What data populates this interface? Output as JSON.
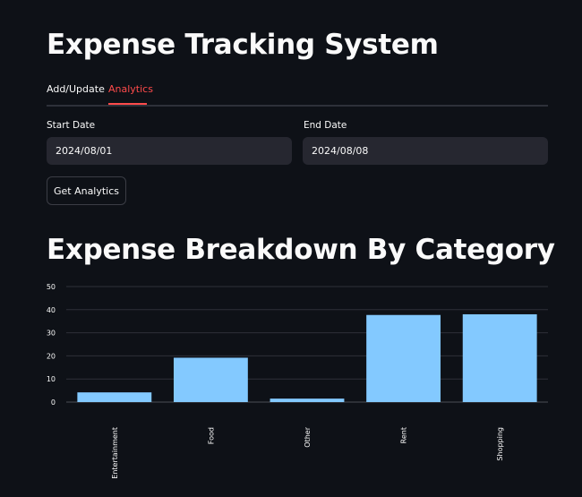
{
  "app": {
    "title": "Expense Tracking System"
  },
  "tabs": [
    {
      "label": "Add/Update",
      "active": false
    },
    {
      "label": "Analytics",
      "active": true
    }
  ],
  "form": {
    "start_date_label": "Start Date",
    "start_date_value": "2024/08/01",
    "end_date_label": "End Date",
    "end_date_value": "2024/08/08",
    "submit_label": "Get Analytics"
  },
  "section": {
    "title": "Expense Breakdown By Category"
  },
  "colors": {
    "background": "#0e1117",
    "accent": "#ff4b4b",
    "bar": "#83c9ff",
    "input_bg": "#262730"
  },
  "chart_data": {
    "type": "bar",
    "categories": [
      "Entertainment",
      "Food",
      "Other",
      "Rent",
      "Shopping"
    ],
    "values": [
      4.2,
      19.2,
      1.5,
      37.7,
      38.0
    ],
    "ylim": [
      0,
      50
    ],
    "yticks": [
      0,
      10,
      20,
      30,
      40,
      50
    ],
    "grid": true,
    "xlabel": "",
    "ylabel": ""
  }
}
